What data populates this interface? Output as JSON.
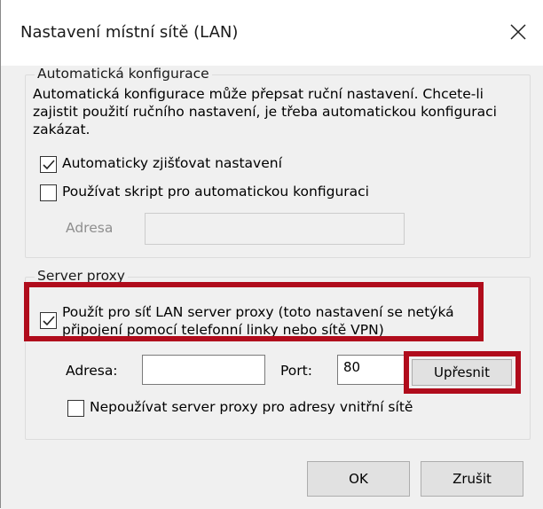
{
  "dialog": {
    "title": "Nastavení místní sítě (LAN)",
    "close_glyph": "close-icon"
  },
  "auto_config": {
    "legend": "Automatická konfigurace",
    "description": "Automatická konfigurace může přepsat ruční nastavení. Chcete-li zajistit použití ručního nastavení, je třeba automatickou konfiguraci zakázat.",
    "auto_detect": {
      "label": "Automaticky zjišťovat nastavení",
      "checked": true
    },
    "use_script": {
      "label": "Používat skript pro automatickou konfiguraci",
      "checked": false
    },
    "address": {
      "label": "Adresa",
      "value": ""
    }
  },
  "proxy": {
    "legend": "Server proxy",
    "use_proxy": {
      "label_line1": "Použít pro síť LAN server proxy (toto nastavení se netýká",
      "label_line2": "připojení pomocí telefonní linky nebo sítě VPN)",
      "checked": true
    },
    "address": {
      "label": "Adresa:",
      "value": ""
    },
    "port": {
      "label": "Port:",
      "value": "80"
    },
    "advanced_label": "Upřesnit",
    "bypass_local": {
      "label": "Nepoužívat server proxy pro adresy vnitřní sítě",
      "checked": false
    }
  },
  "buttons": {
    "ok": "OK",
    "cancel": "Zrušit"
  },
  "highlight_color": "#b00c1c"
}
